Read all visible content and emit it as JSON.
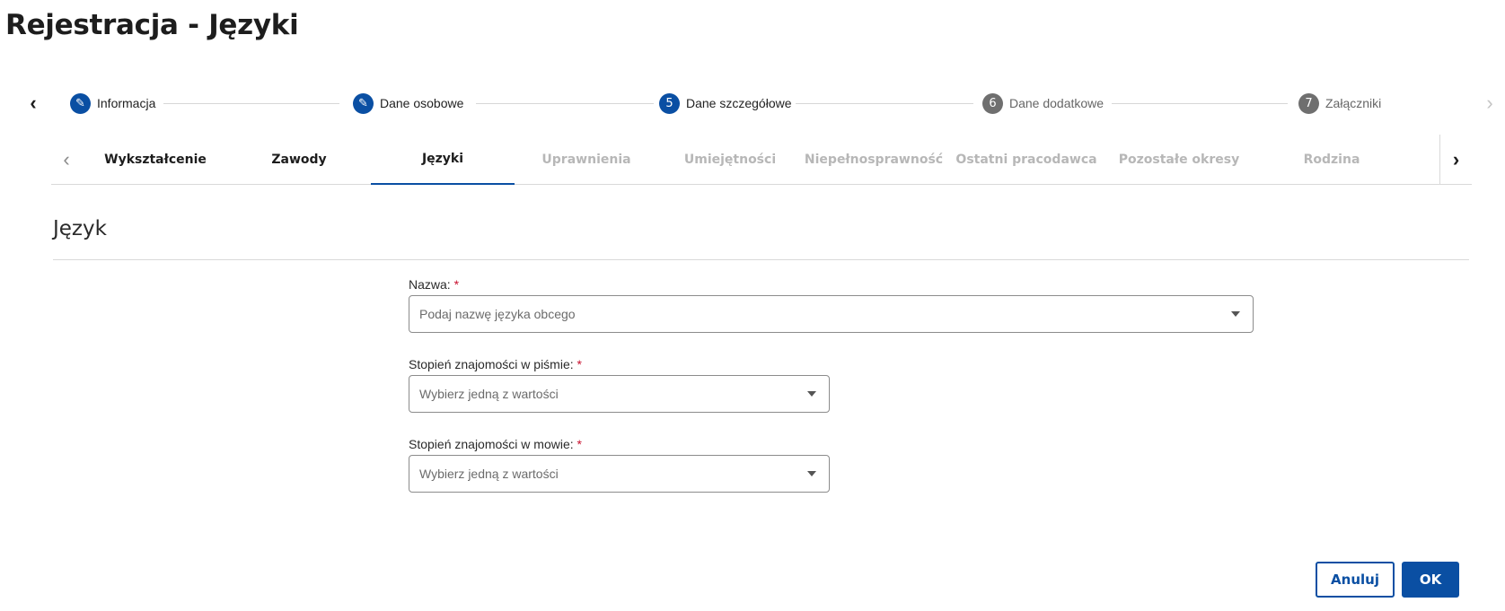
{
  "page": {
    "title": "Rejestracja - Języki"
  },
  "stepper": {
    "steps": [
      {
        "label": "Informacja",
        "badge": "✎",
        "state": "done"
      },
      {
        "label": "Dane osobowe",
        "badge": "✎",
        "state": "done"
      },
      {
        "label": "Dane szczegółowe",
        "badge": "5",
        "state": "active"
      },
      {
        "label": "Dane dodatkowe",
        "badge": "6",
        "state": "future"
      },
      {
        "label": "Załączniki",
        "badge": "7",
        "state": "future"
      }
    ]
  },
  "tabs": {
    "items": [
      {
        "label": "Wykształcenie",
        "state": "enabled"
      },
      {
        "label": "Zawody",
        "state": "enabled"
      },
      {
        "label": "Języki",
        "state": "active"
      },
      {
        "label": "Uprawnienia",
        "state": "disabled"
      },
      {
        "label": "Umiejętności",
        "state": "disabled"
      },
      {
        "label": "Niepełnosprawność",
        "state": "disabled"
      },
      {
        "label": "Ostatni pracodawca",
        "state": "disabled"
      },
      {
        "label": "Pozostałe okresy",
        "state": "disabled"
      },
      {
        "label": "Rodzina",
        "state": "disabled"
      }
    ]
  },
  "section": {
    "title": "Język"
  },
  "form": {
    "required_mark": "*",
    "name": {
      "label": "Nazwa:",
      "placeholder": "Podaj nazwę języka obcego"
    },
    "writing": {
      "label": "Stopień znajomości w piśmie:",
      "placeholder": "Wybierz jedną z wartości"
    },
    "speaking": {
      "label": "Stopień znajomości w mowie:",
      "placeholder": "Wybierz jedną z wartości"
    }
  },
  "actions": {
    "cancel_label": "Anuluj",
    "ok_label": "OK"
  },
  "colors": {
    "primary": "#0a4fa3",
    "required": "#c8102e",
    "future_step": "#6f6f6f",
    "disabled_tab": "#b7b7b7"
  }
}
